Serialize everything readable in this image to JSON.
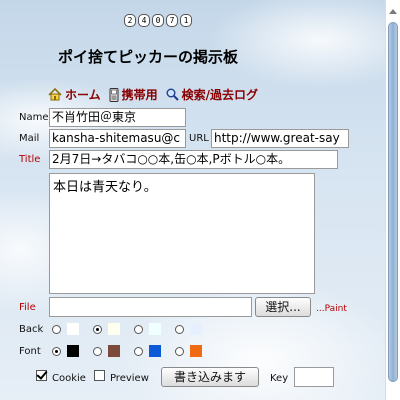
{
  "counter": [
    "2",
    "4",
    "0",
    "7",
    "1"
  ],
  "page_title": "ポイ捨てピッカーの掲示板",
  "nav": {
    "home": "ホーム",
    "mobile": "携帯用",
    "search": "検索/過去ログ"
  },
  "form": {
    "name_label": "Name",
    "name_value": "不肖竹田＠東京",
    "mail_label": "Mail",
    "mail_value": "kansha-shitemasu@c",
    "url_label": "URL",
    "url_value": "http://www.great-say",
    "title_label": "Title",
    "title_value": "2月7日→タバコ○○本,缶○本,Pボトル○本。",
    "body_value": "本日は青天なり。",
    "file_label": "File",
    "browse_label": "選択...",
    "paint_link": "...Paint",
    "back_label": "Back",
    "font_label": "Font",
    "cookie_label": "Cookie",
    "preview_label": "Preview",
    "submit_label": "書き込みます",
    "key_label": "Key"
  },
  "back_colors": [
    {
      "color": "#ffffff",
      "selected": false
    },
    {
      "color": "#fffff0",
      "selected": true
    },
    {
      "color": "#f0ffff",
      "selected": false
    },
    {
      "color": "#e6f0ff",
      "selected": false
    }
  ],
  "font_colors": [
    {
      "color": "#000000",
      "selected": true
    },
    {
      "color": "#7b4a3a",
      "selected": false
    },
    {
      "color": "#0a5ad8",
      "selected": false
    },
    {
      "color": "#ef6a10",
      "selected": false
    }
  ],
  "cookie_checked": true,
  "preview_checked": false
}
